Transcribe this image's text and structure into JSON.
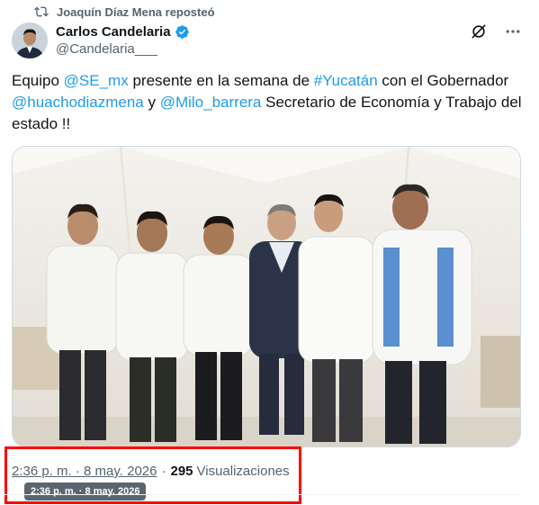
{
  "repost": {
    "label": "Joaquín Díaz Mena reposteó",
    "icon": "repost-icon"
  },
  "author": {
    "name": "Carlos Candelaria",
    "handle": "@Candelaria___",
    "verified_icon": "verified-badge-icon"
  },
  "actions": {
    "grok_icon": "grok-icon",
    "more_icon": "more-options-icon"
  },
  "tweet": {
    "t1": "Equipo ",
    "m1": "@SE_mx",
    "t2": " presente en la semana de ",
    "h1": "#Yucatán",
    "t3": " con el Gobernador ",
    "m2": "@huachodiazmena",
    "t4": " y ",
    "m3": "@Milo_barrera",
    "t5": " Secretario de Economía y Trabajo del estado !!"
  },
  "meta": {
    "timestamp": "2:36 p. m. · 8 may. 2026",
    "separator": "·",
    "views_count": "295",
    "views_label": "Visualizaciones"
  },
  "tooltip": {
    "text": "2:36 p. m. · 8 may. 2026"
  },
  "colors": {
    "link": "#1d9bf0",
    "muted": "#536471",
    "text": "#0f1419",
    "highlight": "#ff0000",
    "verified": "#1d9bf0"
  }
}
